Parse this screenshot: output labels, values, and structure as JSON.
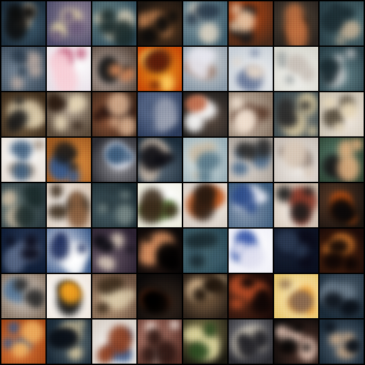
{
  "grid": {
    "rows": 8,
    "cols": 8,
    "tiles": [
      {
        "bg": [
          "#1d2f3e",
          "#4a6a7e"
        ],
        "blobs": [
          "#cdb79a",
          "#0b0b0b"
        ]
      },
      {
        "bg": [
          "#4a4a6a",
          "#9a8a9a"
        ],
        "blobs": [
          "#e8d9a8",
          "#6a5a7a"
        ]
      },
      {
        "bg": [
          "#2d4a5a",
          "#6f8a8a"
        ],
        "blobs": [
          "#cfc6b0",
          "#1a2a2a"
        ]
      },
      {
        "bg": [
          "#1a1410",
          "#5a3a20"
        ],
        "blobs": [
          "#c08050",
          "#0a0a0a"
        ]
      },
      {
        "bg": [
          "#3a5a6a",
          "#8aa0a8"
        ],
        "blobs": [
          "#d8d0c0",
          "#2a3a4a"
        ]
      },
      {
        "bg": [
          "#4a2a1a",
          "#c84a10"
        ],
        "blobs": [
          "#1a1a1a",
          "#e8c8a8"
        ]
      },
      {
        "bg": [
          "#2a2420",
          "#5a4a3a"
        ],
        "blobs": [
          "#0a0a0a",
          "#c07040"
        ]
      },
      {
        "bg": [
          "#2a4048",
          "#5a7a80"
        ],
        "blobs": [
          "#b8a890",
          "#1a2a30"
        ]
      },
      {
        "bg": [
          "#3a4a5a",
          "#7a8a9a"
        ],
        "blobs": [
          "#b8a8a0",
          "#2a3a4a"
        ]
      },
      {
        "bg": [
          "#e8e0e8",
          "#ffffff"
        ],
        "blobs": [
          "#c05a7a",
          "#f8d0d8"
        ]
      },
      {
        "bg": [
          "#5a4a40",
          "#c8b8b0"
        ],
        "blobs": [
          "#1a1a1a",
          "#d88a5a"
        ]
      },
      {
        "bg": [
          "#c84a08",
          "#f0a020"
        ],
        "blobs": [
          "#ffd060",
          "#5a1a08"
        ]
      },
      {
        "bg": [
          "#8a9aa8",
          "#d8d8d8"
        ],
        "blobs": [
          "#9a7a6a",
          "#e8e8f0"
        ]
      },
      {
        "bg": [
          "#c8d0d8",
          "#f0f0f0"
        ],
        "blobs": [
          "#6a7a9a",
          "#e8d8c8"
        ]
      },
      {
        "bg": [
          "#d8d8d0",
          "#f4f4f0"
        ],
        "blobs": [
          "#9aa0a0",
          "#c8c0b8"
        ]
      },
      {
        "bg": [
          "#2a4048",
          "#6a8a90"
        ],
        "blobs": [
          "#c8c8c8",
          "#1a2a30"
        ]
      },
      {
        "bg": [
          "#3a2a1a",
          "#8a7050"
        ],
        "blobs": [
          "#d8c8a8",
          "#1a1a1a"
        ]
      },
      {
        "bg": [
          "#5a4a3a",
          "#b0a090"
        ],
        "blobs": [
          "#e8d8b8",
          "#2a1a10"
        ]
      },
      {
        "bg": [
          "#3a2418",
          "#a06040"
        ],
        "blobs": [
          "#1a0a08",
          "#d8b090"
        ]
      },
      {
        "bg": [
          "#2a3a5a",
          "#6a7a9a"
        ],
        "blobs": [
          "#4a5a7a",
          "#9aa0b0"
        ]
      },
      {
        "bg": [
          "#1a1a1a",
          "#5a4a40"
        ],
        "blobs": [
          "#ffffff",
          "#c07050"
        ]
      },
      {
        "bg": [
          "#8a7868",
          "#d8c8b8"
        ],
        "blobs": [
          "#5a3a2a",
          "#f0e0d0"
        ]
      },
      {
        "bg": [
          "#3a4a50",
          "#8a8a80"
        ],
        "blobs": [
          "#d8c8a0",
          "#2a2a2a"
        ]
      },
      {
        "bg": [
          "#c8c0b0",
          "#f0e8e0"
        ],
        "blobs": [
          "#5a5040",
          "#e8d8b8"
        ]
      },
      {
        "bg": [
          "#e8e0d8",
          "#ffffff"
        ],
        "blobs": [
          "#9a8a7a",
          "#3a5a7a"
        ]
      },
      {
        "bg": [
          "#a05a20",
          "#e09040"
        ],
        "blobs": [
          "#3a5a8a",
          "#1a1a1a"
        ]
      },
      {
        "bg": [
          "#2a2a30",
          "#9a9aa0"
        ],
        "blobs": [
          "#e8e8f0",
          "#3a5a7a"
        ]
      },
      {
        "bg": [
          "#1a2a38",
          "#5a6a78"
        ],
        "blobs": [
          "#c8b8a8",
          "#0a0a10"
        ]
      },
      {
        "bg": [
          "#9ab0b8",
          "#e0e8e8"
        ],
        "blobs": [
          "#c8b8a0",
          "#5a7a8a"
        ]
      },
      {
        "bg": [
          "#a8a098",
          "#e0d8d0"
        ],
        "blobs": [
          "#4a6a8a",
          "#2a2a2a"
        ]
      },
      {
        "bg": [
          "#c8c0b8",
          "#f0ece8"
        ],
        "blobs": [
          "#8a7a70",
          "#d8c8b8"
        ]
      },
      {
        "bg": [
          "#2a4030",
          "#5a8070"
        ],
        "blobs": [
          "#1a1a1a",
          "#e0b080"
        ]
      },
      {
        "bg": [
          "#2a3a40",
          "#6a7a78"
        ],
        "blobs": [
          "#c8b8a0",
          "#1a2a2a"
        ]
      },
      {
        "bg": [
          "#d8c8b8",
          "#ffffff"
        ],
        "blobs": [
          "#3a2a1a",
          "#8a6040"
        ]
      },
      {
        "bg": [
          "#1a2a30",
          "#4a6068"
        ],
        "blobs": [
          "#2a3a40",
          "#7a8a88"
        ]
      },
      {
        "bg": [
          "#e8e8d8",
          "#ffffff"
        ],
        "blobs": [
          "#5a8a3a",
          "#3a2a1a"
        ]
      },
      {
        "bg": [
          "#d8d0c8",
          "#f8f0e8"
        ],
        "blobs": [
          "#c05a20",
          "#2a1a10"
        ]
      },
      {
        "bg": [
          "#3a5a7a",
          "#8a9ab0"
        ],
        "blobs": [
          "#f0f0f8",
          "#2a4a8a"
        ]
      },
      {
        "bg": [
          "#c8b8a8",
          "#f0e8e0"
        ],
        "blobs": [
          "#8a3a2a",
          "#1a1a1a"
        ]
      },
      {
        "bg": [
          "#1a1410",
          "#5a3a28"
        ],
        "blobs": [
          "#c05010",
          "#0a0808"
        ]
      },
      {
        "bg": [
          "#0a1830",
          "#2a3a58"
        ],
        "blobs": [
          "#5a6a88",
          "#0a0a18"
        ]
      },
      {
        "bg": [
          "#3a5a8a",
          "#e8e8f0"
        ],
        "blobs": [
          "#ffffff",
          "#1a2a5a"
        ]
      },
      {
        "bg": [
          "#2a2030",
          "#6a5a68"
        ],
        "blobs": [
          "#d8c8b8",
          "#0a0a10"
        ]
      },
      {
        "bg": [
          "#0a0808",
          "#3a2018"
        ],
        "blobs": [
          "#d89060",
          "#000000"
        ]
      },
      {
        "bg": [
          "#2a4a58",
          "#5a7a80"
        ],
        "blobs": [
          "#3a5a68",
          "#1a2a30"
        ]
      },
      {
        "bg": [
          "#f0f0f8",
          "#ffffff"
        ],
        "blobs": [
          "#3a5aaa",
          "#e0e0f0"
        ]
      },
      {
        "bg": [
          "#0a1020",
          "#1a2438"
        ],
        "blobs": [
          "#0a0a18",
          "#2a3850"
        ]
      },
      {
        "bg": [
          "#1a0a08",
          "#5a2a10"
        ],
        "blobs": [
          "#e08030",
          "#0a0404"
        ]
      },
      {
        "bg": [
          "#8a7868",
          "#e0d8d0"
        ],
        "blobs": [
          "#5a7a9a",
          "#2a2a2a"
        ]
      },
      {
        "bg": [
          "#f0e8e0",
          "#ffffff"
        ],
        "blobs": [
          "#0a0a0a",
          "#f0a020"
        ]
      },
      {
        "bg": [
          "#6a5040",
          "#c0a080"
        ],
        "blobs": [
          "#d8c8a8",
          "#3a2a1a"
        ]
      },
      {
        "bg": [
          "#0a0808",
          "#3a2a20"
        ],
        "blobs": [
          "#8a3a18",
          "#000000"
        ]
      },
      {
        "bg": [
          "#2a2018",
          "#8a6a4a"
        ],
        "blobs": [
          "#d8b890",
          "#1a1008"
        ]
      },
      {
        "bg": [
          "#1a0a08",
          "#5a2a18"
        ],
        "blobs": [
          "#c05028",
          "#0a0404"
        ]
      },
      {
        "bg": [
          "#e8c870",
          "#fff0c8"
        ],
        "blobs": [
          "#f0a030",
          "#8a6a50"
        ]
      },
      {
        "bg": [
          "#1a2a38",
          "#4a5a68"
        ],
        "blobs": [
          "#6a7a88",
          "#0a1018"
        ]
      },
      {
        "bg": [
          "#a04010",
          "#e08040"
        ],
        "blobs": [
          "#3a5a8a",
          "#f0b060"
        ]
      },
      {
        "bg": [
          "#1a2a38",
          "#5a6a70"
        ],
        "blobs": [
          "#d8c8a0",
          "#0a1018"
        ]
      },
      {
        "bg": [
          "#d8d0c8",
          "#ffffff"
        ],
        "blobs": [
          "#3a5a8a",
          "#8a3a1a"
        ]
      },
      {
        "bg": [
          "#5a3028",
          "#c08878"
        ],
        "blobs": [
          "#f0e0d8",
          "#2a1410"
        ]
      },
      {
        "bg": [
          "#1a1810",
          "#8a8050"
        ],
        "blobs": [
          "#e0d8a0",
          "#2a4a20"
        ]
      },
      {
        "bg": [
          "#2a2a30",
          "#8a8a90"
        ],
        "blobs": [
          "#c8c0b0",
          "#1a1a20"
        ]
      },
      {
        "bg": [
          "#0a0808",
          "#5a3a30"
        ],
        "blobs": [
          "#e8c8b8",
          "#000000"
        ]
      },
      {
        "bg": [
          "#1a2a38",
          "#5a6a78"
        ],
        "blobs": [
          "#c8a888",
          "#0a1018"
        ]
      }
    ]
  }
}
